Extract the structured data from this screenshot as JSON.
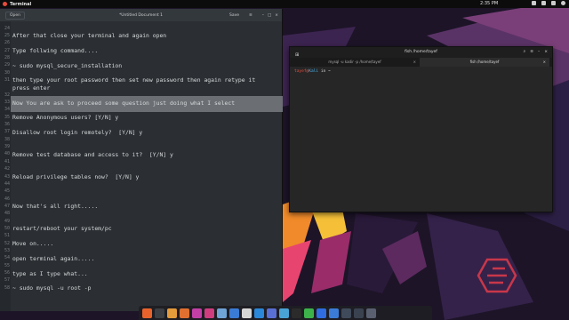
{
  "top_panel": {
    "app_name": "Terminal",
    "clock": "2:35 PM",
    "tray_icons": [
      "network-icon",
      "volume-icon",
      "battery-icon",
      "power-icon"
    ]
  },
  "gedit": {
    "open_label": "Open",
    "title": "*Untitled Document 1",
    "save_label": "Save",
    "menu_icon": "hamburger-menu-icon",
    "lines": [
      {
        "num": "24",
        "text": ""
      },
      {
        "num": "25",
        "text": "After that close your terminal and again open"
      },
      {
        "num": "26",
        "text": ""
      },
      {
        "num": "27",
        "text": "Type follwing command...."
      },
      {
        "num": "28",
        "text": ""
      },
      {
        "num": "29",
        "text": "~ sudo mysql_secure_installation"
      },
      {
        "num": "30",
        "text": ""
      },
      {
        "num": "31",
        "text": "then type your root password then set new password then again retype it"
      },
      {
        "num": "",
        "text": "press enter"
      },
      {
        "num": "32",
        "text": ""
      },
      {
        "num": "33",
        "text": "Now You are ask to proceed some question just doing what I select"
      },
      {
        "num": "34",
        "text": ""
      },
      {
        "num": "35",
        "text": "Remove Anonymous users? [Y/N] y"
      },
      {
        "num": "36",
        "text": ""
      },
      {
        "num": "37",
        "text": "Disallow root login remotely?  [Y/N] y"
      },
      {
        "num": "38",
        "text": ""
      },
      {
        "num": "39",
        "text": ""
      },
      {
        "num": "40",
        "text": "Remove test database and access to it?  [Y/N] y"
      },
      {
        "num": "41",
        "text": ""
      },
      {
        "num": "42",
        "text": ""
      },
      {
        "num": "43",
        "text": "Reload privilege tables now?  [Y/N] y"
      },
      {
        "num": "44",
        "text": ""
      },
      {
        "num": "45",
        "text": ""
      },
      {
        "num": "46",
        "text": ""
      },
      {
        "num": "47",
        "text": "Now that's all right....."
      },
      {
        "num": "48",
        "text": ""
      },
      {
        "num": "49",
        "text": ""
      },
      {
        "num": "50",
        "text": "restart/reboot your system/pc"
      },
      {
        "num": "51",
        "text": ""
      },
      {
        "num": "52",
        "text": "Move on....."
      },
      {
        "num": "53",
        "text": ""
      },
      {
        "num": "54",
        "text": "open terminal again....."
      },
      {
        "num": "55",
        "text": ""
      },
      {
        "num": "56",
        "text": "type as I type what..."
      },
      {
        "num": "57",
        "text": ""
      },
      {
        "num": "58",
        "text": "~ sudo mysql -u root -p"
      }
    ]
  },
  "terminal": {
    "title": "fish /home/tayef",
    "tabs": [
      {
        "label": "mysql -u kadir -p  /home/tayef"
      },
      {
        "label": "fish /home/tayef"
      }
    ],
    "prompt_user": "tayef",
    "prompt_at": "@",
    "prompt_host": "Kali",
    "prompt_tail": " in ~"
  },
  "dock": {
    "icons": [
      {
        "name": "firefox-icon",
        "color": "#e8632b"
      },
      {
        "name": "terminal-icon",
        "color": "#3c3f43"
      },
      {
        "name": "files-icon",
        "color": "#e49b3a"
      },
      {
        "name": "image-viewer-icon",
        "color": "#e0702f"
      },
      {
        "name": "video-player-icon",
        "color": "#c23fa6"
      },
      {
        "name": "store-icon",
        "color": "#cf3d7f"
      },
      {
        "name": "text-editor-icon",
        "color": "#6fa4d6"
      },
      {
        "name": "settings-icon",
        "color": "#3a7bd5"
      },
      {
        "name": "chrome-icon",
        "color": "#d6d6d6"
      },
      {
        "name": "vscode-icon",
        "color": "#2b87d8"
      },
      {
        "name": "tweaks-icon",
        "color": "#5a6fd4"
      },
      {
        "name": "screenshot-icon",
        "color": "#49a3d6"
      },
      {
        "name": "monitor-icon",
        "color": "#2b2b2b"
      },
      {
        "name": "camera-icon",
        "color": "#3db24b"
      },
      {
        "name": "music-icon",
        "color": "#2f6de0"
      },
      {
        "name": "clock-icon",
        "color": "#3b7cd8"
      },
      {
        "name": "calculator-icon",
        "color": "#3f4a5a"
      },
      {
        "name": "phone-icon",
        "color": "#3a4250"
      },
      {
        "name": "trash-icon",
        "color": "#5a6070"
      }
    ]
  }
}
